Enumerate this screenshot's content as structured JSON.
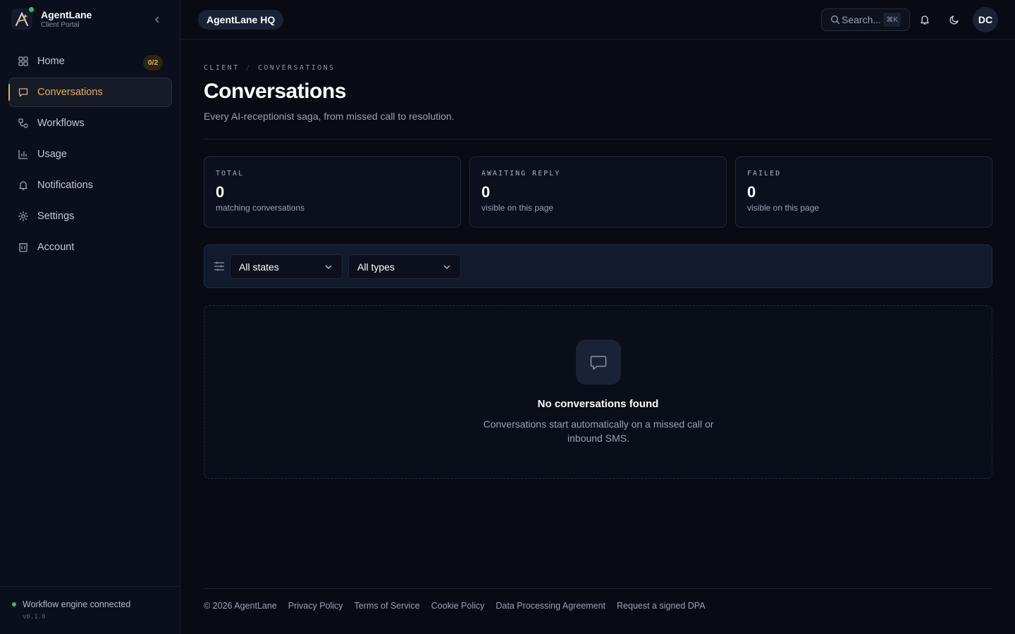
{
  "brand": {
    "name": "AgentLane",
    "subtitle": "Client Portal"
  },
  "nav": {
    "items": [
      {
        "label": "Home",
        "badge": "0/2",
        "icon": "grid-icon"
      },
      {
        "label": "Conversations",
        "icon": "chat-icon",
        "active": true
      },
      {
        "label": "Workflows",
        "icon": "workflow-icon"
      },
      {
        "label": "Usage",
        "icon": "bar-chart-icon"
      },
      {
        "label": "Notifications",
        "icon": "bell-icon"
      },
      {
        "label": "Settings",
        "icon": "gear-icon"
      },
      {
        "label": "Account",
        "icon": "building-icon"
      }
    ]
  },
  "status": {
    "text": "Workflow engine connected",
    "version": "v0.1.0",
    "color": "#22c55e"
  },
  "topbar": {
    "workspace": "AgentLane HQ",
    "search_placeholder": "Search...",
    "search_shortcut": "⌘K",
    "avatar_initials": "DC"
  },
  "page": {
    "breadcrumb": [
      "CLIENT",
      "CONVERSATIONS"
    ],
    "title": "Conversations",
    "subtitle": "Every AI-receptionist saga, from missed call to resolution."
  },
  "stats": [
    {
      "label": "TOTAL",
      "value": "0",
      "hint": "matching conversations"
    },
    {
      "label": "AWAITING REPLY",
      "value": "0",
      "hint": "visible on this page"
    },
    {
      "label": "FAILED",
      "value": "0",
      "hint": "visible on this page"
    }
  ],
  "filters": {
    "state": "All states",
    "type": "All types"
  },
  "empty_state": {
    "title": "No conversations found",
    "description": "Conversations start automatically on a missed call or inbound SMS."
  },
  "footer": {
    "links": [
      "© 2026 AgentLane",
      "Privacy Policy",
      "Terms of Service",
      "Cookie Policy",
      "Data Processing Agreement",
      "Request a signed DPA"
    ]
  },
  "colors": {
    "accent": "#e0b25c",
    "background": "#080b14",
    "sidebar": "#0b0f1c"
  }
}
